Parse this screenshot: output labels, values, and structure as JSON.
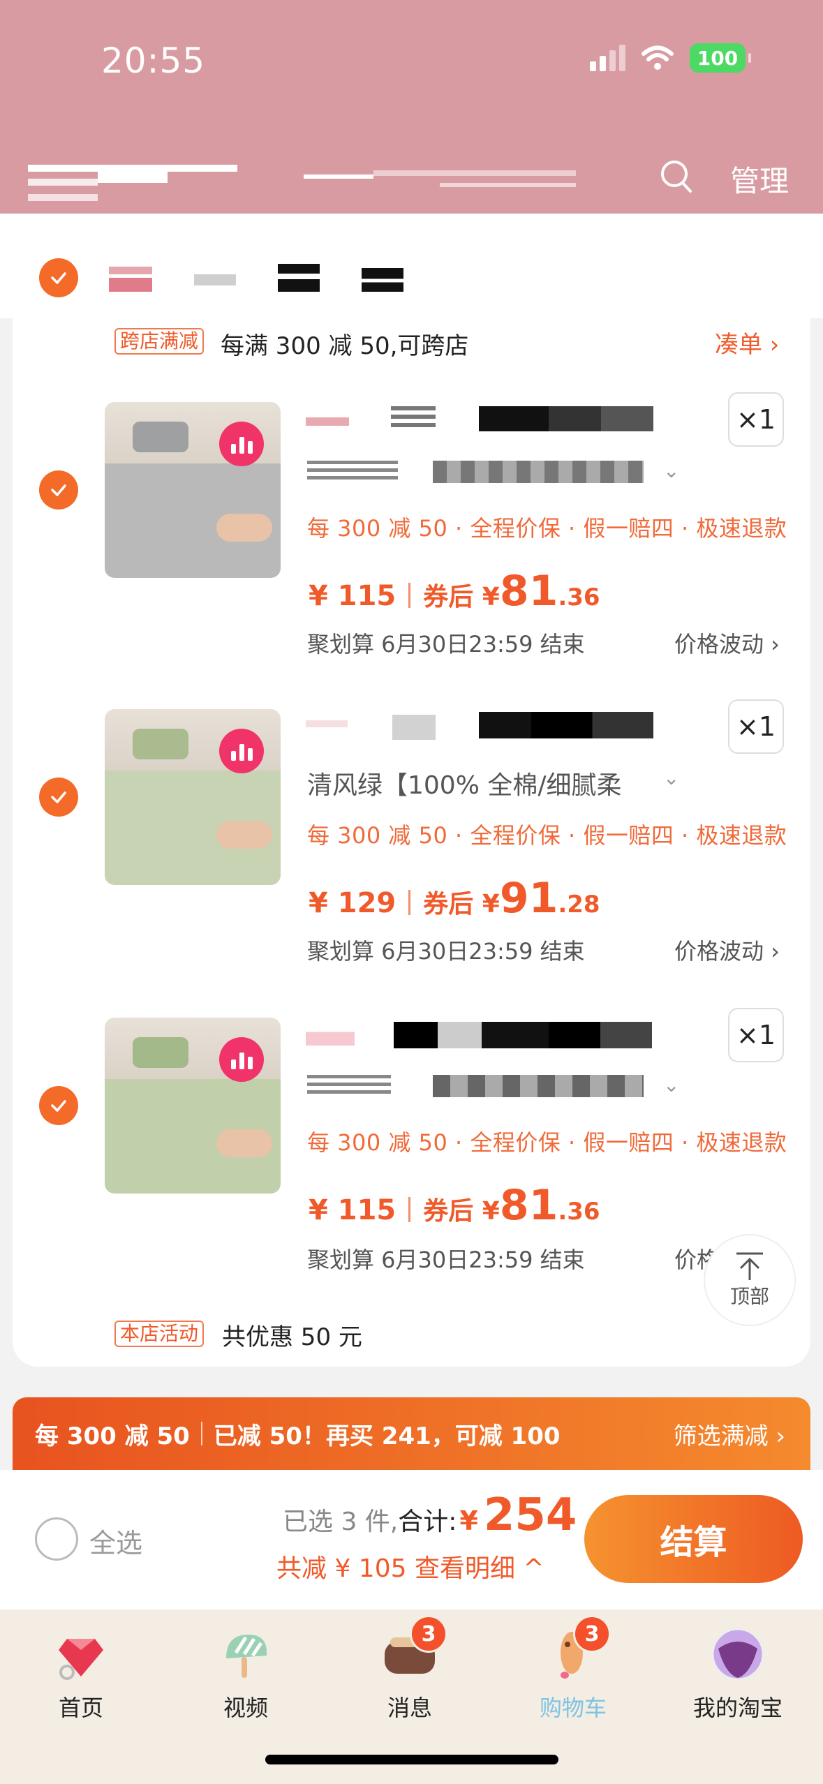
{
  "status": {
    "time": "20:55",
    "battery": "100"
  },
  "header": {
    "manage": "管理"
  },
  "shop": {
    "promo_tag": "跨店满减",
    "promo_text": "每满 300 减 50,可跨店",
    "promo_link": "凑单 ›",
    "activity_tag": "本店活动",
    "activity_text": "共优惠 50 元"
  },
  "items": [
    {
      "qty": "×1",
      "sku": "",
      "benefits": "每 300 减 50 · 全程价保 · 假一赔四 · 极速退款",
      "price": "¥ 115",
      "after_label": "券后 ¥",
      "after_int": "81",
      "after_dec": ".36",
      "deadline": "聚划算 6月30日23:59 结束",
      "fluct": "价格波动 ›",
      "bed_color": "#b9b9ba",
      "pillow_color": "#9ea0a2"
    },
    {
      "qty": "×1",
      "sku": "清风绿【100% 全棉/细腻柔",
      "benefits": "每 300 减 50 · 全程价保 · 假一赔四 · 极速退款",
      "price": "¥ 129",
      "after_label": "券后 ¥",
      "after_int": "91",
      "after_dec": ".28",
      "deadline": "聚划算 6月30日23:59 结束",
      "fluct": "价格波动 ›",
      "bed_color": "#c7d3b2",
      "pillow_color": "#a9bb8f"
    },
    {
      "qty": "×1",
      "sku": "",
      "benefits": "每 300 减 50 · 全程价保 · 假一赔四 · 极速退款",
      "price": "¥ 115",
      "after_label": "券后 ¥",
      "after_int": "81",
      "after_dec": ".36",
      "deadline": "聚划算 6月30日23:59 结束",
      "fluct": "价格波动",
      "bed_color": "#c1cfab",
      "pillow_color": "#a3b98a"
    }
  ],
  "totop": "顶部",
  "banner": {
    "part1": "每 300 减 50",
    "part2": "已减 50！再买 241，可减 100",
    "filter": "筛选满减 ›"
  },
  "settle": {
    "select_all": "全选",
    "selected": "已选 3 件,",
    "total_label": "合计:",
    "currency": "¥",
    "total": "254",
    "discount": "共减 ¥ 105  查看明细 ^",
    "pay": "结算"
  },
  "tabs": [
    {
      "label": "首页",
      "icon": "home-gem-icon"
    },
    {
      "label": "视频",
      "icon": "video-icecream-icon"
    },
    {
      "label": "消息",
      "icon": "message-icon",
      "badge": "3"
    },
    {
      "label": "购物车",
      "icon": "cart-icon",
      "badge": "3",
      "active": true
    },
    {
      "label": "我的淘宝",
      "icon": "my-taobao-icon"
    }
  ]
}
